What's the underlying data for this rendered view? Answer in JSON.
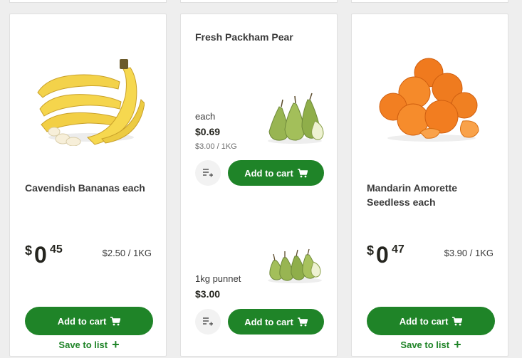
{
  "cards": [
    {
      "title": "Cavendish Bananas each",
      "image": "banana-bunch-image",
      "price": {
        "dollar": "$",
        "whole": "0",
        "cents": "45"
      },
      "unit_price": "$2.50 / 1KG",
      "add_label": "Add to cart",
      "save_label": "Save to list"
    },
    {
      "title": "Fresh Packham Pear",
      "variants": [
        {
          "label": "each",
          "price": "$0.69",
          "unit_price": "$3.00 / 1KG",
          "image": "pears-each-image",
          "add_label": "Add to cart"
        },
        {
          "label": "1kg punnet",
          "price": "$3.00",
          "unit_price": "",
          "image": "pears-punnet-image",
          "add_label": "Add to cart"
        }
      ]
    },
    {
      "title": "Mandarin Amorette Seedless each",
      "image": "mandarins-image",
      "price": {
        "dollar": "$",
        "whole": "0",
        "cents": "47"
      },
      "unit_price": "$3.90 / 1KG",
      "add_label": "Add to cart",
      "save_label": "Save to list"
    }
  ],
  "icons": {
    "cart": "cart-icon",
    "plus": "plus-icon",
    "add_to_list": "add-to-list-icon"
  },
  "colors": {
    "accent": "#1f8428",
    "page_bg": "#eeeeee",
    "card_bg": "#ffffff"
  }
}
